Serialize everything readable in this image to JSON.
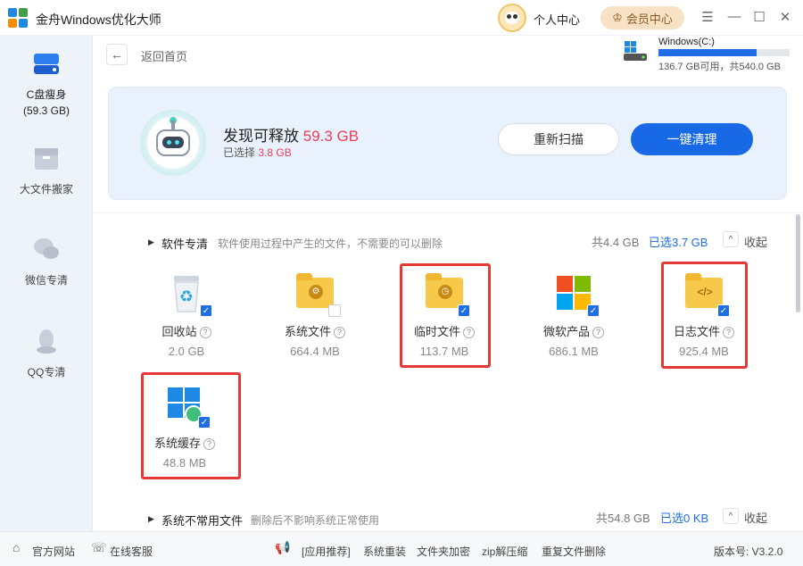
{
  "app": {
    "title": "金舟Windows优化大师",
    "personal_center": "个人中心",
    "member_center": "会员中心"
  },
  "window_controls": {
    "menu": "☰",
    "minimize": "—",
    "maximize": "☐",
    "close": "✕"
  },
  "sidebar": {
    "items": [
      {
        "label": "C盘瘦身",
        "sub": "(59.3 GB)"
      },
      {
        "label": "大文件搬家"
      },
      {
        "label": "微信专清"
      },
      {
        "label": "QQ专清"
      }
    ]
  },
  "header": {
    "back_label": "返回首页"
  },
  "drive": {
    "name": "Windows(C:)",
    "info": "136.7 GB可用，共540.0 GB",
    "used_fraction": 0.747
  },
  "banner": {
    "found_prefix": "发现可释放",
    "found_value": "59.3 GB",
    "selected_prefix": "已选择",
    "selected_value": "3.8 GB",
    "rescan": "重新扫描",
    "clean": "一键清理"
  },
  "sections": [
    {
      "title": "软件专清",
      "desc": "软件使用过程中产生的文件，不需要的可以删除",
      "total": "共4.4 GB",
      "selected": "已选3.7 GB",
      "collapse": "收起",
      "items": [
        {
          "name": "回收站",
          "size": "2.0 GB",
          "checked": true
        },
        {
          "name": "系统文件",
          "size": "664.4 MB",
          "checked": false
        },
        {
          "name": "临时文件",
          "size": "113.7 MB",
          "checked": true
        },
        {
          "name": "微软产品",
          "size": "686.1 MB",
          "checked": true
        },
        {
          "name": "日志文件",
          "size": "925.4 MB",
          "checked": true
        },
        {
          "name": "系统缓存",
          "size": "48.8 MB",
          "checked": true
        }
      ]
    },
    {
      "title": "系统不常用文件",
      "desc": "删除后不影响系统正常使用",
      "total": "共54.8 GB",
      "selected": "已选0 KB",
      "collapse": "收起"
    }
  ],
  "icons": {
    "check": "✓",
    "question": "?",
    "collapse_chevron": "^"
  },
  "footer": {
    "official": "官方网站",
    "service": "在线客服",
    "recommend": "[应用推荐]",
    "links": [
      "系统重装",
      "文件夹加密",
      "zip解压缩",
      "重复文件删除"
    ],
    "version": "版本号: V3.2.0"
  }
}
